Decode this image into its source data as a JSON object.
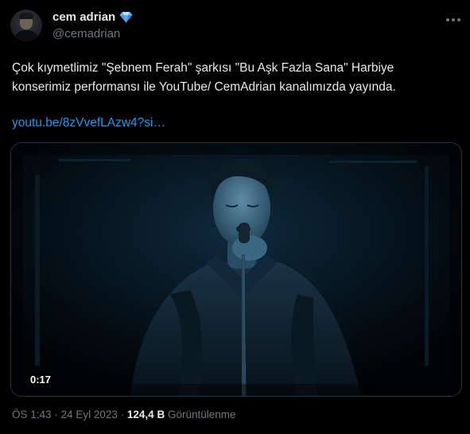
{
  "author": {
    "display_name": "cem adrian",
    "handle": "@cemadrian",
    "badge_icon": "diamond-icon",
    "badge_color": "#6fb8f5"
  },
  "tweet": {
    "text_line1": "Çok kıymetlimiz \"Şebnem Ferah\" şarkısı \"Bu Aşk Fazla Sana\" Harbiye",
    "text_line2": "konserimiz performansı ile YouTube/ CemAdrian kanalımızda yayında.",
    "link": "youtu.be/8zVvefLAzw4?si…",
    "link_color": "#1d9bf0"
  },
  "media": {
    "type": "video",
    "timestamp": "0:17"
  },
  "meta": {
    "time": "ÖS 1:43",
    "separator": "·",
    "date": "24 Eyl 2023",
    "views_count": "124,4 B",
    "views_label": "Görüntülenme"
  },
  "icons": {
    "more": "more-horizontal-icon"
  },
  "colors": {
    "background": "#000000",
    "text_primary": "#e7e9ea",
    "text_secondary": "#71767b",
    "border": "#2f3336"
  }
}
